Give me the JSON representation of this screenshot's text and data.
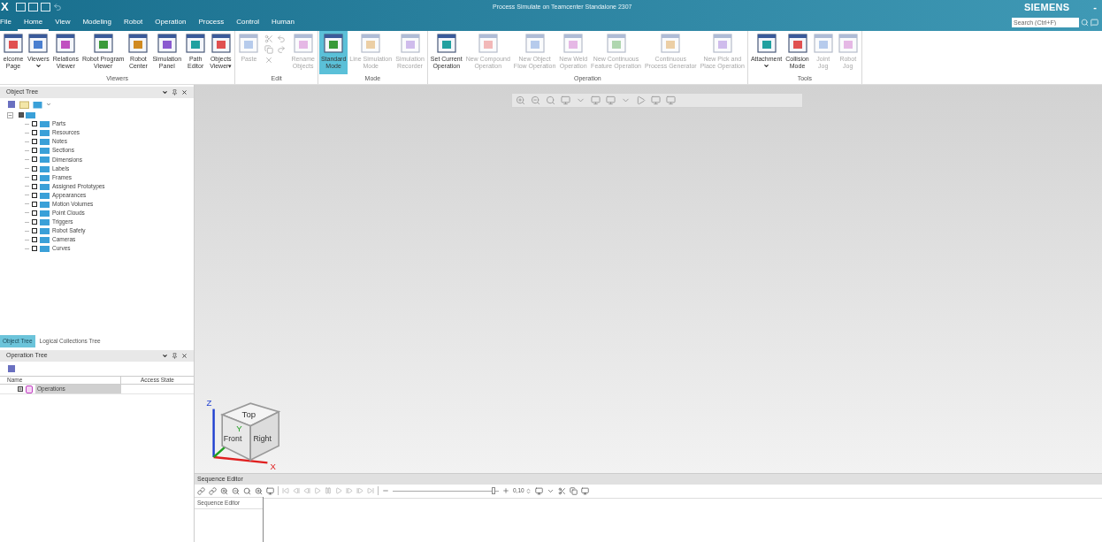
{
  "app": {
    "logo": "X",
    "title": "Process Simulate on Teamcenter Standalone 2307",
    "brand": "SIEMENS",
    "minimize": "-",
    "search": {
      "placeholder": "Search (Ctrl+F)"
    }
  },
  "menu_tabs": [
    {
      "label": "File",
      "selected": false
    },
    {
      "label": "Home",
      "selected": true
    },
    {
      "label": "View",
      "selected": false
    },
    {
      "label": "Modeling",
      "selected": false
    },
    {
      "label": "Robot",
      "selected": false
    },
    {
      "label": "Operation",
      "selected": false
    },
    {
      "label": "Process",
      "selected": false
    },
    {
      "label": "Control",
      "selected": false
    },
    {
      "label": "Human",
      "selected": false
    }
  ],
  "ribbon": [
    {
      "label": "Viewers",
      "buttons": [
        {
          "lines": [
            "elcome",
            "Page"
          ],
          "disabled": false,
          "selected": false,
          "dropdown": false
        },
        {
          "lines": [
            "Viewers"
          ],
          "disabled": false,
          "selected": false,
          "dropdown": true
        },
        {
          "lines": [
            "Relations",
            "Viewer"
          ],
          "disabled": false,
          "selected": false,
          "dropdown": false
        },
        {
          "lines": [
            "Robot Program",
            "Viewer"
          ],
          "disabled": false,
          "selected": false,
          "dropdown": false
        },
        {
          "lines": [
            "Robot",
            "Center"
          ],
          "disabled": false,
          "selected": false,
          "dropdown": false
        },
        {
          "lines": [
            "Simulation",
            "Panel"
          ],
          "disabled": false,
          "selected": false,
          "dropdown": false
        },
        {
          "lines": [
            "Path",
            "Editor"
          ],
          "disabled": false,
          "selected": false,
          "dropdown": false
        },
        {
          "lines": [
            "Objects",
            "Viewer▾"
          ],
          "disabled": false,
          "selected": false,
          "dropdown": false
        }
      ]
    },
    {
      "label": "Edit",
      "buttons": [
        {
          "lines": [
            "Paste"
          ],
          "disabled": true,
          "selected": false,
          "dropdown": false
        },
        {
          "lines": [
            "Rename",
            "Objects"
          ],
          "disabled": true,
          "selected": false,
          "dropdown": false
        }
      ]
    },
    {
      "label": "Mode",
      "buttons": [
        {
          "lines": [
            "Standard",
            "Mode"
          ],
          "disabled": false,
          "selected": true,
          "dropdown": false
        },
        {
          "lines": [
            "Line Simulation",
            "Mode"
          ],
          "disabled": true,
          "selected": false,
          "dropdown": false
        },
        {
          "lines": [
            "Simulation",
            "Recorder"
          ],
          "disabled": true,
          "selected": false,
          "dropdown": false
        }
      ]
    },
    {
      "label": "Operation",
      "buttons": [
        {
          "lines": [
            "Set Current",
            "Operation"
          ],
          "disabled": false,
          "selected": false,
          "dropdown": false
        },
        {
          "lines": [
            "New Compound",
            "Operation"
          ],
          "disabled": true,
          "selected": false,
          "dropdown": false
        },
        {
          "lines": [
            "New Object",
            "Flow Operation"
          ],
          "disabled": true,
          "selected": false,
          "dropdown": false
        },
        {
          "lines": [
            "New Weld",
            "Operation"
          ],
          "disabled": true,
          "selected": false,
          "dropdown": false
        },
        {
          "lines": [
            "New Continuous",
            "Feature Operation"
          ],
          "disabled": true,
          "selected": false,
          "dropdown": false
        },
        {
          "lines": [
            "Continuous",
            "Process Generator"
          ],
          "disabled": true,
          "selected": false,
          "dropdown": false
        },
        {
          "lines": [
            "New Pick and",
            "Place Operation"
          ],
          "disabled": true,
          "selected": false,
          "dropdown": false
        }
      ]
    },
    {
      "label": "Tools",
      "buttons": [
        {
          "lines": [
            "Attachment"
          ],
          "disabled": false,
          "selected": false,
          "dropdown": true
        },
        {
          "lines": [
            "Collision",
            "Mode"
          ],
          "disabled": false,
          "selected": false,
          "dropdown": false
        },
        {
          "lines": [
            "Joint",
            "Jog"
          ],
          "disabled": true,
          "selected": false,
          "dropdown": false
        },
        {
          "lines": [
            "Robot",
            "Jog"
          ],
          "disabled": true,
          "selected": false,
          "dropdown": false
        }
      ]
    }
  ],
  "object_tree": {
    "title": "Object Tree",
    "root": {
      "expanded": true,
      "checked": true,
      "children": [
        {
          "label": "Parts",
          "checked": false
        },
        {
          "label": "Resources",
          "checked": false
        },
        {
          "label": "Notes",
          "checked": false
        },
        {
          "label": "Sections",
          "checked": false
        },
        {
          "label": "Dimensions",
          "checked": false
        },
        {
          "label": "Labels",
          "checked": false
        },
        {
          "label": "Frames",
          "checked": false
        },
        {
          "label": "Assigned Prototypes",
          "checked": false
        },
        {
          "label": "Appearances",
          "checked": false
        },
        {
          "label": "Motion Volumes",
          "checked": false
        },
        {
          "label": "Point Clouds",
          "checked": false
        },
        {
          "label": "Triggers",
          "checked": false
        },
        {
          "label": "Robot Safety",
          "checked": false
        },
        {
          "label": "Cameras",
          "checked": false
        },
        {
          "label": "Curves",
          "checked": false
        }
      ]
    }
  },
  "tree_tabs": [
    {
      "label": "Object Tree",
      "selected": true
    },
    {
      "label": "Logical Collections Tree",
      "selected": false
    }
  ],
  "operation_tree": {
    "title": "Operation Tree",
    "columns": [
      "Name",
      "Access State"
    ],
    "rows": [
      {
        "name": "Operations",
        "expanded": false,
        "selected": true
      }
    ]
  },
  "nav_cube": {
    "top": "Top",
    "front": "Front",
    "right": "Right",
    "axes": [
      "Z",
      "Y",
      "X"
    ]
  },
  "sequence_editor": {
    "title": "Sequence Editor",
    "speed": "0,10",
    "slider": {
      "level": 0.95
    },
    "column": "Sequence Editor"
  }
}
